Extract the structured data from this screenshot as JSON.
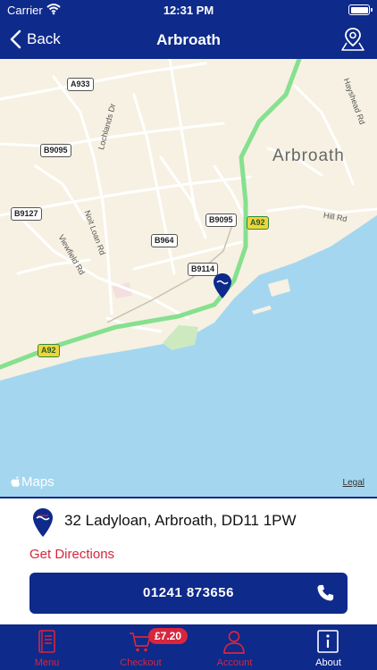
{
  "status_bar": {
    "carrier": "Carrier",
    "time": "12:31 PM"
  },
  "nav": {
    "back_label": "Back",
    "title": "Arbroath"
  },
  "map": {
    "town_label": "Arbroath",
    "road_labels": [
      "A933",
      "B9095",
      "B9127",
      "B964",
      "B9095",
      "B9114",
      "A92",
      "A92"
    ],
    "street_labels": [
      "Lochlands Dr",
      "Noit Loan Rd",
      "Viewfield Rd",
      "Hill Rd",
      "Hayshead Rd"
    ],
    "attribution": "Maps",
    "legal": "Legal"
  },
  "location": {
    "address": "32 Ladyloan, Arbroath, DD11 1PW",
    "directions_label": "Get Directions",
    "phone": "01241 873656"
  },
  "tabs": [
    {
      "label": "Menu",
      "icon": "menu-book-icon"
    },
    {
      "label": "Checkout",
      "icon": "cart-icon",
      "badge": "£7.20"
    },
    {
      "label": "Account",
      "icon": "person-icon"
    },
    {
      "label": "About",
      "icon": "info-icon",
      "active": true
    }
  ],
  "colors": {
    "primary": "#0e2a8a",
    "accent": "#d7263d",
    "sea": "#a4d7ef",
    "land": "#f6f1e3",
    "road_major": "#86e08f"
  }
}
